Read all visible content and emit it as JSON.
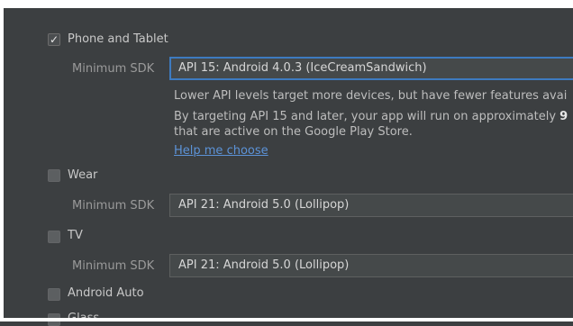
{
  "phone_tablet": {
    "label": "Phone and Tablet",
    "checked": true,
    "min_sdk_label": "Minimum SDK",
    "min_sdk_value": "API 15: Android 4.0.3 (IceCreamSandwich)",
    "info_line1": "Lower API levels target more devices, but have fewer features avai",
    "info_line2": "By targeting API 15 and later, your app will run on approximately",
    "info_line2_bold": "9",
    "info_line3": "that are active on the Google Play Store.",
    "help_link": "Help me choose"
  },
  "wear": {
    "label": "Wear",
    "checked": false,
    "min_sdk_label": "Minimum SDK",
    "min_sdk_value": "API 21: Android 5.0 (Lollipop)"
  },
  "tv": {
    "label": "TV",
    "checked": false,
    "min_sdk_label": "Minimum SDK",
    "min_sdk_value": "API 21: Android 5.0 (Lollipop)"
  },
  "android_auto": {
    "label": "Android Auto",
    "checked": false
  },
  "glass": {
    "label": "Glass",
    "checked": false
  },
  "colors": {
    "background": "#3c3f41",
    "focus_border": "#3d7bc0",
    "link": "#5c93d8"
  }
}
